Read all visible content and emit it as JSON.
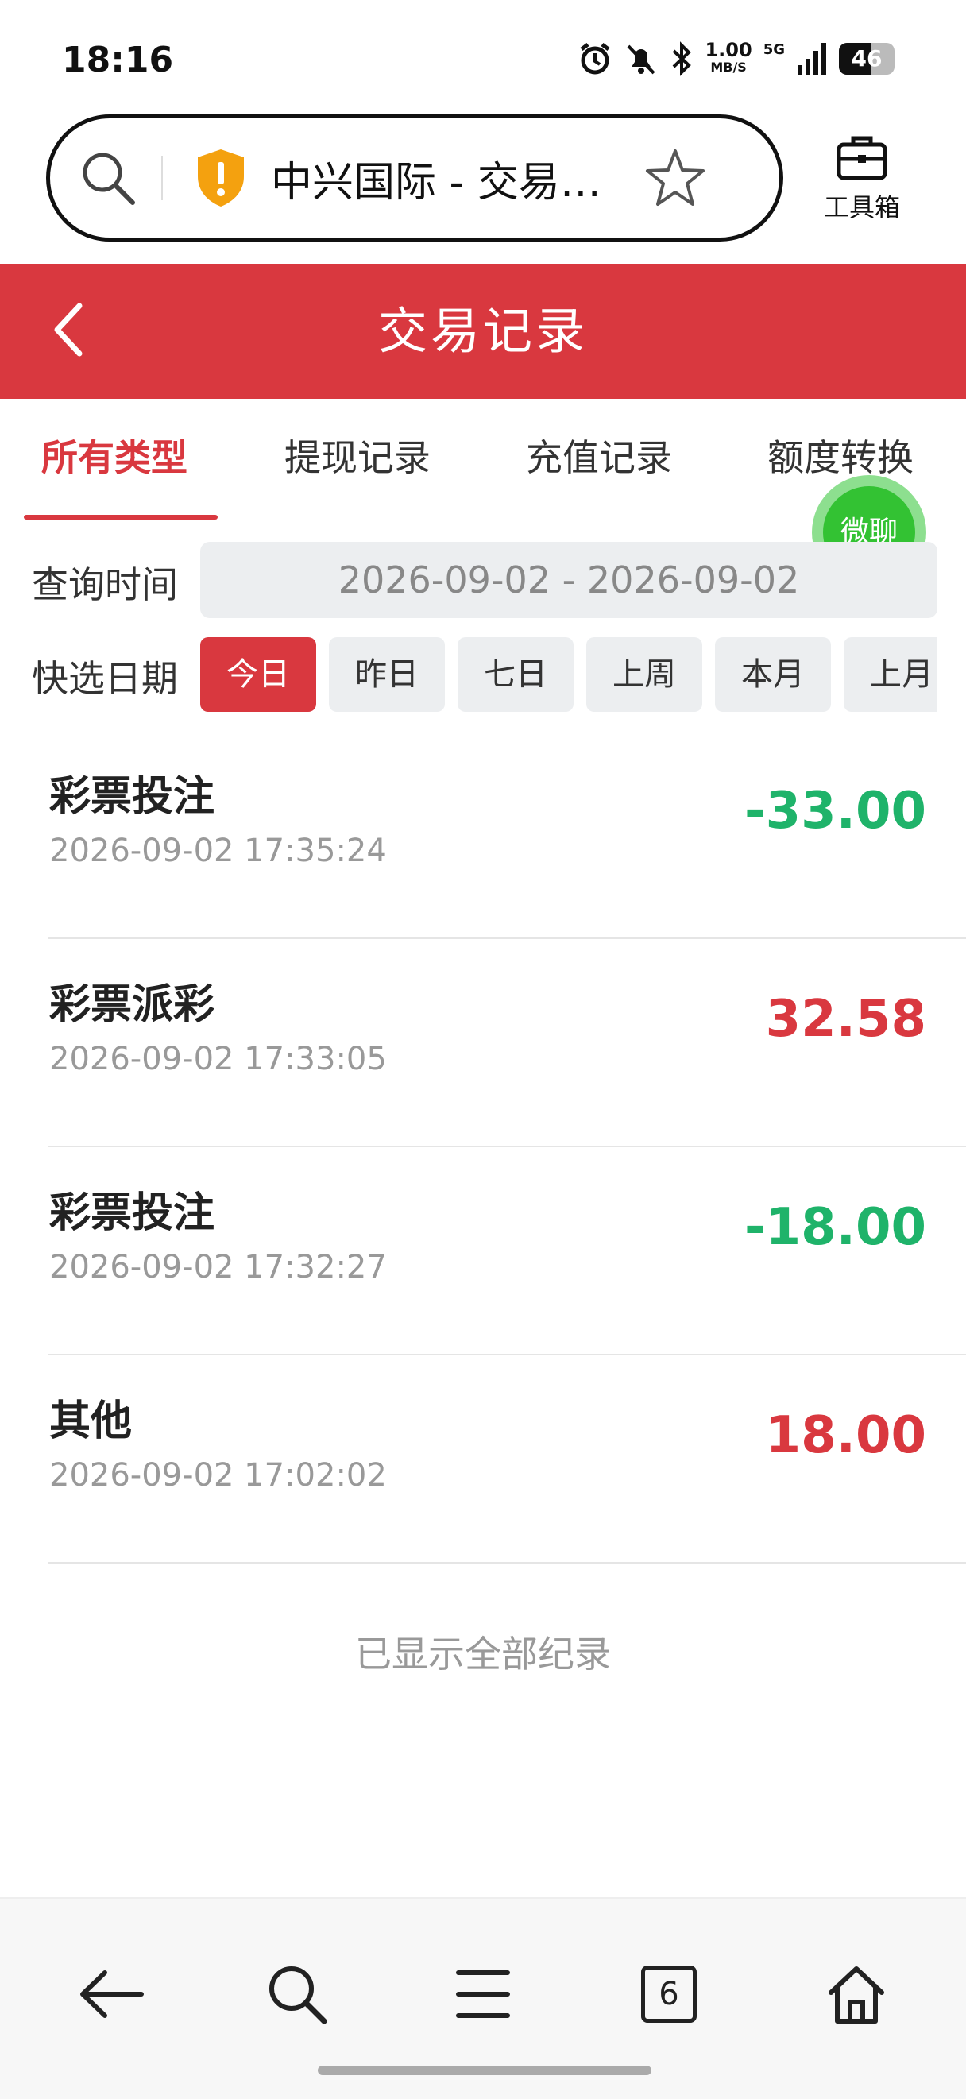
{
  "status_bar": {
    "time": "18:16",
    "net_speed_value": "1.00",
    "net_speed_unit": "MB/S",
    "network": "5G",
    "battery": "46"
  },
  "browser": {
    "url_text": "中兴国际 - 交易…",
    "toolbox_label": "工具箱",
    "tab_count": "6"
  },
  "header": {
    "title": "交易记录"
  },
  "tabs": [
    {
      "label": "所有类型",
      "active": true
    },
    {
      "label": "提现记录",
      "active": false
    },
    {
      "label": "充值记录",
      "active": false
    },
    {
      "label": "额度转换",
      "active": false
    }
  ],
  "chat_button": "微聊",
  "query": {
    "time_label": "查询时间",
    "date_range": "2026-09-02 - 2026-09-02",
    "quick_label": "快选日期",
    "quick_options": [
      "今日",
      "昨日",
      "七日",
      "上周",
      "本月",
      "上月"
    ],
    "selected": "今日"
  },
  "records": [
    {
      "type": "彩票投注",
      "time": "2026-09-02 17:35:24",
      "amount": "-33.00",
      "sign": "neg"
    },
    {
      "type": "彩票派彩",
      "time": "2026-09-02 17:33:05",
      "amount": "32.58",
      "sign": "pos"
    },
    {
      "type": "彩票投注",
      "time": "2026-09-02 17:32:27",
      "amount": "-18.00",
      "sign": "neg"
    },
    {
      "type": "其他",
      "time": "2026-09-02 17:02:02",
      "amount": "18.00",
      "sign": "pos"
    }
  ],
  "footer_text": "已显示全部纪录",
  "colors": {
    "header_red": "#d9383f",
    "negative_green": "#1fb36a",
    "positive_red": "#d9383f",
    "chat_green": "#33c233"
  }
}
